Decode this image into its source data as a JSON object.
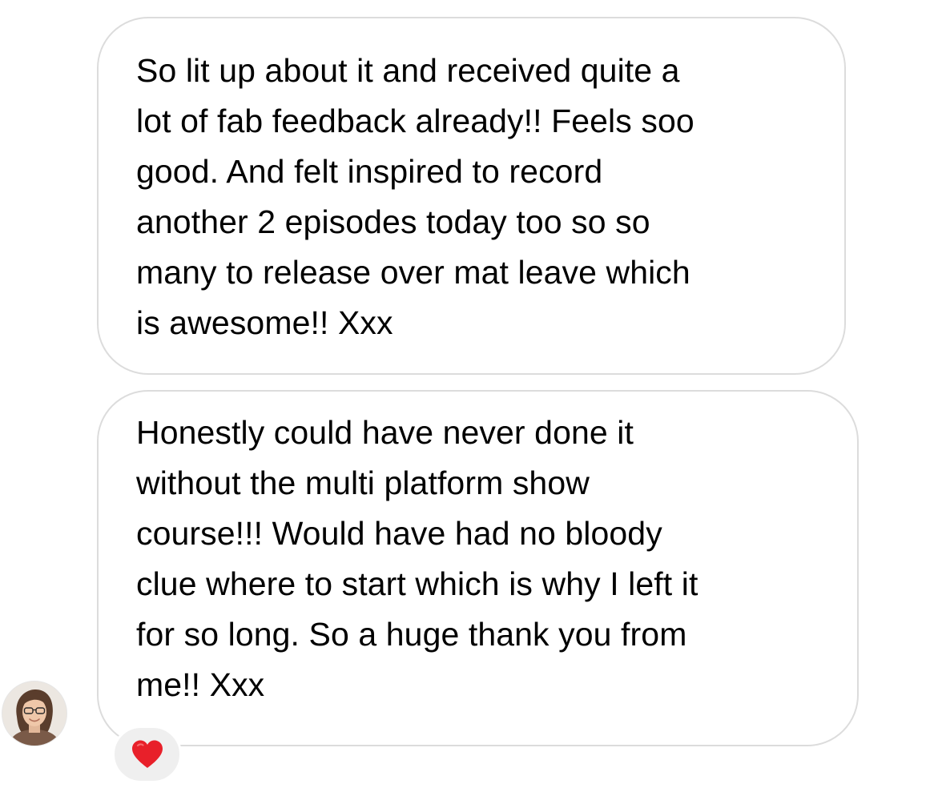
{
  "messages": [
    {
      "lines": [
        "So lit up about it and received quite a",
        "lot of fab feedback already!! Feels soo",
        "good. And felt inspired to record",
        "another 2 episodes today too so so",
        "many to release over mat leave which",
        "is awesome!! Xxx"
      ]
    },
    {
      "lines": [
        "Honestly could have never done it",
        "without the multi platform show",
        "course!!! Would have had no bloody",
        "clue where to start which is why I left it",
        "for so long. So a huge thank you from",
        "me!! Xxx"
      ]
    }
  ],
  "avatar": {
    "icon": "user-avatar"
  },
  "reaction": {
    "icon": "red-heart-icon",
    "color": "#e8202a"
  },
  "colors": {
    "bubble_border": "#dcdcdc",
    "text": "#000000",
    "reaction_bg": "#efefef"
  }
}
